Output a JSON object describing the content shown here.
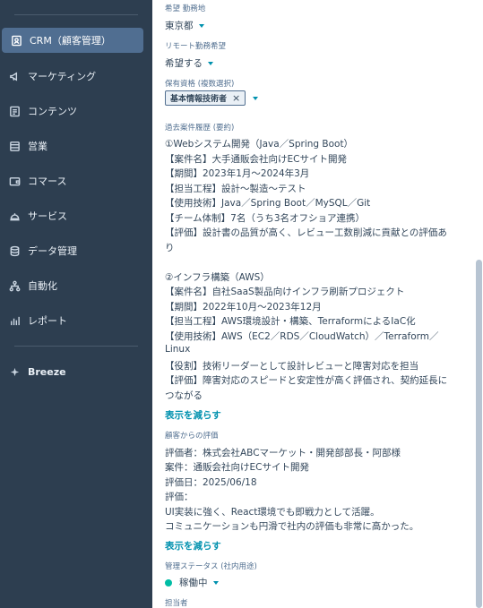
{
  "sidebar": {
    "items": [
      {
        "label": "CRM（顧客管理）",
        "icon": "contacts-icon"
      },
      {
        "label": "マーケティング",
        "icon": "megaphone-icon"
      },
      {
        "label": "コンテンツ",
        "icon": "document-icon"
      },
      {
        "label": "営業",
        "icon": "sales-icon"
      },
      {
        "label": "コマース",
        "icon": "wallet-icon"
      },
      {
        "label": "サービス",
        "icon": "service-icon"
      },
      {
        "label": "データ管理",
        "icon": "database-icon"
      },
      {
        "label": "自動化",
        "icon": "workflow-icon"
      },
      {
        "label": "レポート",
        "icon": "bar-chart-icon"
      }
    ],
    "breeze": "Breeze"
  },
  "fields": {
    "location": {
      "label": "希望 勤務地",
      "value": "東京都"
    },
    "remote": {
      "label": "リモート勤務希望",
      "value": "希望する"
    },
    "certs": {
      "label": "保有資格 (複数選択)",
      "tag": "基本情報技術者",
      "tag_remove": "×"
    },
    "history": {
      "label": "過去案件履歴 (要約)"
    },
    "review": {
      "label": "顧客からの評価"
    },
    "status": {
      "label": "管理ステータス (社内用途)",
      "value": "稼働中"
    },
    "owner": {
      "label": "担当者"
    }
  },
  "history_lines": [
    "①Webシステム開発（Java／Spring Boot）",
    "【案件名】大手通販会社向けECサイト開発",
    "【期間】2023年1月〜2024年3月",
    "【担当工程】設計〜製造〜テスト",
    "【使用技術】Java／Spring Boot／MySQL／Git",
    "【チーム体制】7名（うち3名オフショア連携）",
    "【評価】設計書の品質が高く、レビュー工数削減に貢献との評価あ",
    "り",
    "②インフラ構築（AWS）",
    "【案件名】自社SaaS製品向けインフラ刷新プロジェクト",
    "【期間】2022年10月〜2023年12月",
    "【担当工程】AWS環境設計・構築、TerraformによるIaC化",
    "【使用技術】AWS（EC2／RDS／CloudWatch）／Terraform／",
    "Linux",
    "【役割】技術リーダーとして設計レビューと障害対応を担当",
    "【評価】障害対応のスピードと安定性が高く評価され、契約延長に",
    "つながる"
  ],
  "show_less": "表示を減らす",
  "review_lines": [
    "評価者：株式会社ABCマーケット・開発部部長・阿部様",
    "案件：通販会社向けECサイト開発",
    "評価日：2025/06/18",
    "評価：",
    "UI実装に強く、React環境でも即戦力として活躍。",
    "コミュニケーションも円滑で社内の評価も非常に高かった。"
  ],
  "colors": {
    "sidebar_bg": "#2d3e50",
    "active_bg": "#506e91",
    "link": "#0091ae",
    "status_dot": "#00bda5"
  }
}
